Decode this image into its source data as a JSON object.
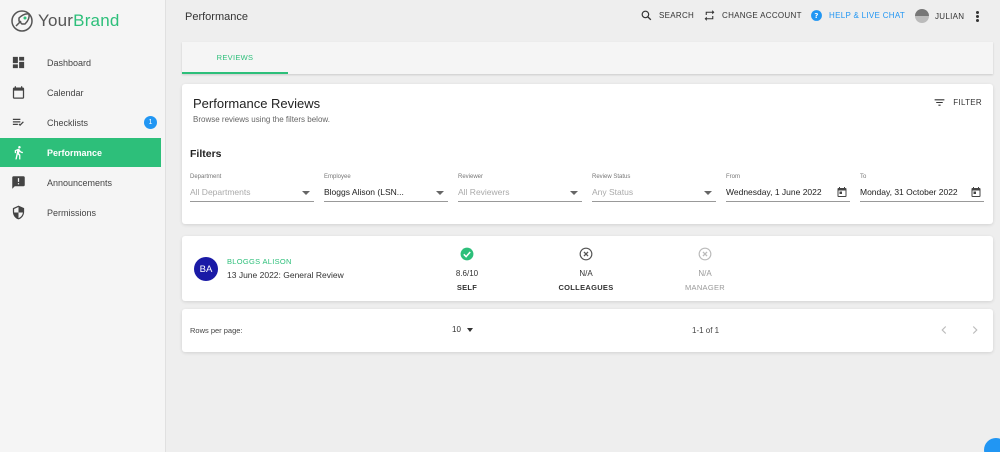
{
  "brand": {
    "part1": "Your",
    "part2": "Brand"
  },
  "sidebar": {
    "items": [
      {
        "label": "Dashboard",
        "icon": "dashboard-icon",
        "active": false
      },
      {
        "label": "Calendar",
        "icon": "calendar-icon",
        "active": false
      },
      {
        "label": "Checklists",
        "icon": "checklist-icon",
        "active": false,
        "badge": "1"
      },
      {
        "label": "Performance",
        "icon": "walk-icon",
        "active": true
      },
      {
        "label": "Announcements",
        "icon": "announcement-icon",
        "active": false
      },
      {
        "label": "Permissions",
        "icon": "shield-icon",
        "active": false
      }
    ]
  },
  "header": {
    "title": "Performance",
    "search": "SEARCH",
    "change_account": "CHANGE ACCOUNT",
    "help": "HELP & LIVE CHAT",
    "user": "JULIAN"
  },
  "tabs": [
    {
      "label": "REVIEWS",
      "active": true
    }
  ],
  "reviews_card": {
    "title": "Performance Reviews",
    "subtitle": "Browse reviews using the filters below.",
    "filter_button": "FILTER",
    "filters_heading": "Filters",
    "fields": [
      {
        "label": "Department",
        "value": "All Departments",
        "placeholder": true,
        "kind": "select"
      },
      {
        "label": "Employee",
        "value": "Bloggs Alison (LSN...",
        "placeholder": false,
        "kind": "select"
      },
      {
        "label": "Reviewer",
        "value": "All Reviewers",
        "placeholder": true,
        "kind": "select"
      },
      {
        "label": "Review Status",
        "value": "Any Status",
        "placeholder": true,
        "kind": "select"
      },
      {
        "label": "From",
        "value": "Wednesday, 1 June 2022",
        "placeholder": false,
        "kind": "date"
      },
      {
        "label": "To",
        "value": "Monday, 31 October 2022",
        "placeholder": false,
        "kind": "date"
      }
    ]
  },
  "review": {
    "initials": "BA",
    "name": "BLOGGS ALISON",
    "description": "13 June 2022: General Review",
    "scores": [
      {
        "value": "8.6/10",
        "label": "SELF",
        "status": "complete"
      },
      {
        "value": "N/A",
        "label": "COLLEAGUES",
        "status": "not-applicable"
      },
      {
        "value": "N/A",
        "label": "MANAGER",
        "status": "not-applicable-muted"
      }
    ]
  },
  "pagination": {
    "rows_per_page_label": "Rows per page:",
    "rows_per_page": "10",
    "range": "1-1 of 1"
  },
  "colors": {
    "accent": "#2dbf7a",
    "link": "#2196f3",
    "avatar": "#1a1aa6"
  }
}
